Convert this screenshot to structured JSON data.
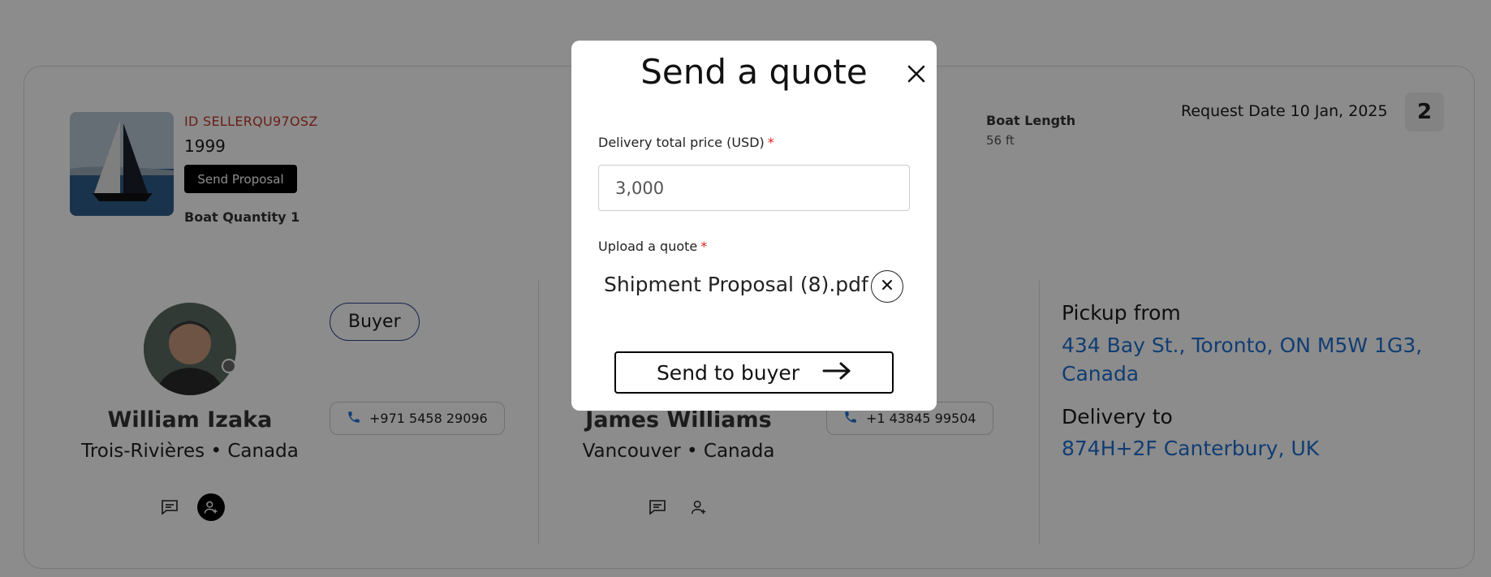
{
  "listing": {
    "id_text": "ID SELLERQU97OSZ",
    "year": "1999",
    "send_proposal_label": "Send Proposal",
    "quantity_text": "Boat Quantity 1",
    "spec_label": "Boat Length",
    "spec_value": "56 ft",
    "request_date": "Request Date 10 Jan, 2025",
    "count": "2"
  },
  "buyer": {
    "role": "Buyer",
    "name": "William Izaka",
    "location": "Trois-Rivières • Canada",
    "phone": "+971 5458 29096"
  },
  "seller": {
    "name": "James Williams",
    "location": "Vancouver • Canada",
    "phone": "+1 43845 99504"
  },
  "route": {
    "pickup_label": "Pickup from",
    "pickup_address": "434 Bay St., Toronto, ON M5W 1G3, Canada",
    "delivery_label": "Delivery to",
    "delivery_address": "874H+2F Canterbury, UK"
  },
  "modal": {
    "title": "Send a quote",
    "price_label": "Delivery total price (USD)",
    "price_value": "3,000",
    "upload_label": "Upload a quote",
    "required_mark": "*",
    "file_name": "Shipment Proposal (8).pdf",
    "submit_label": "Send to buyer"
  },
  "icons": {
    "close": "close-icon",
    "phone": "phone-icon",
    "chat": "chat-icon",
    "add_user": "add-user-icon",
    "arrow": "arrow-right-icon"
  },
  "colors": {
    "id_text": "#c0392b",
    "link": "#1f6fd1",
    "required": "#e02020",
    "phone_icon": "#1f6fd1",
    "badge_border": "#2c3e8f"
  }
}
